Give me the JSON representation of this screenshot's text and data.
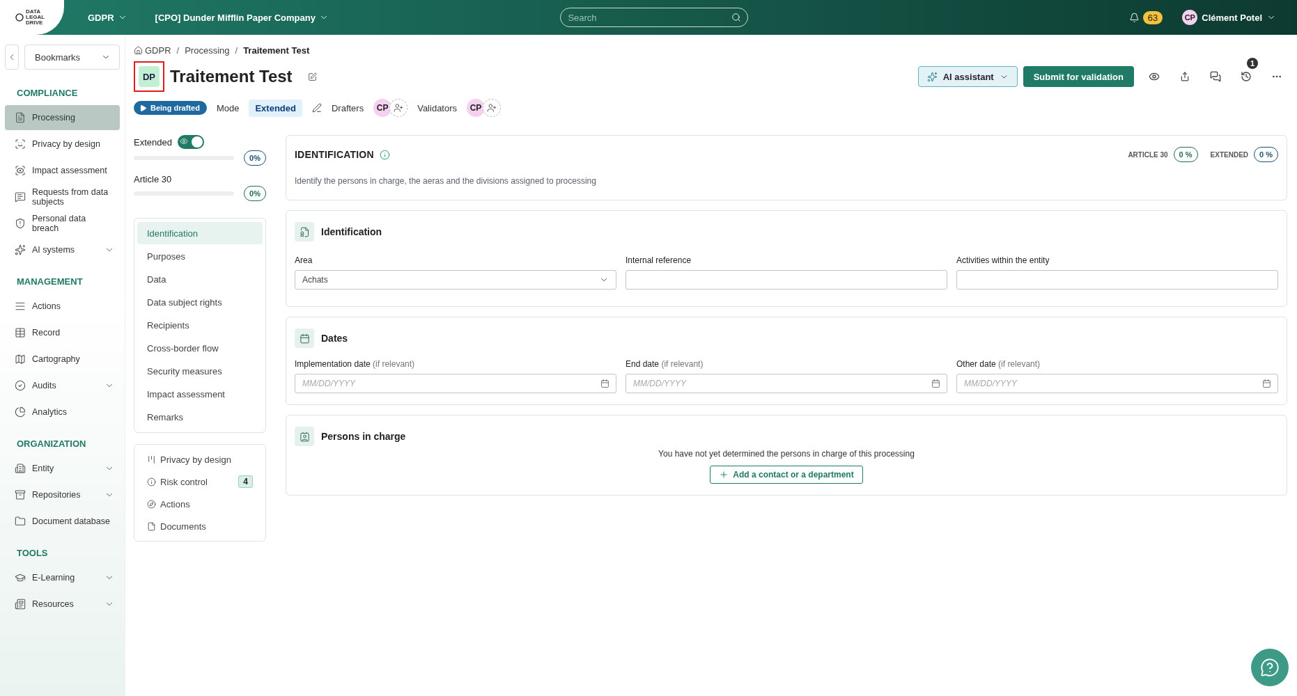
{
  "topbar": {
    "logo_lines": [
      "DATA",
      "LEGAL",
      "DRIVE"
    ],
    "module": "GDPR",
    "company": "[CPO] Dunder Mifflin Paper Company",
    "search": {
      "placeholder": "Search"
    },
    "notifications": "63",
    "user": {
      "initials": "CP",
      "name": "Clément Potel"
    }
  },
  "sidebar": {
    "bookmarks": "Bookmarks",
    "sections": [
      {
        "title": "COMPLIANCE",
        "items": [
          {
            "label": "Processing",
            "selected": true,
            "submenu": false
          },
          {
            "label": "Privacy by design",
            "selected": false,
            "submenu": false
          },
          {
            "label": "Impact assessment",
            "selected": false,
            "submenu": false
          },
          {
            "label": "Requests from data subjects",
            "selected": false,
            "submenu": false
          },
          {
            "label": "Personal data breach",
            "selected": false,
            "submenu": false
          },
          {
            "label": "AI systems",
            "selected": false,
            "submenu": true
          }
        ]
      },
      {
        "title": "MANAGEMENT",
        "items": [
          {
            "label": "Actions",
            "selected": false,
            "submenu": false
          },
          {
            "label": "Record",
            "selected": false,
            "submenu": false
          },
          {
            "label": "Cartography",
            "selected": false,
            "submenu": false
          },
          {
            "label": "Audits",
            "selected": false,
            "submenu": true
          },
          {
            "label": "Analytics",
            "selected": false,
            "submenu": false
          }
        ]
      },
      {
        "title": "ORGANIZATION",
        "items": [
          {
            "label": "Entity",
            "selected": false,
            "submenu": true
          },
          {
            "label": "Repositories",
            "selected": false,
            "submenu": true
          },
          {
            "label": "Document database",
            "selected": false,
            "submenu": false
          }
        ]
      },
      {
        "title": "TOOLS",
        "items": [
          {
            "label": "E-Learning",
            "selected": false,
            "submenu": true
          },
          {
            "label": "Resources",
            "selected": false,
            "submenu": true
          }
        ]
      }
    ]
  },
  "breadcrumb": [
    "GDPR",
    "Processing",
    "Traitement Test"
  ],
  "breadcrumb_separator": "/",
  "header": {
    "badge": "DP",
    "highlighted": true,
    "title": "Traitement Test",
    "ai_button": "AI assistant",
    "submit_button": "Submit for validation",
    "history_count": "1"
  },
  "status_row": {
    "status": "Being drafted",
    "mode_label": "Mode",
    "mode": "Extended",
    "drafters_label": "Drafters",
    "drafters": [
      "CP"
    ],
    "validators_label": "Validators",
    "validators": [
      "CP"
    ]
  },
  "progress": [
    {
      "label": "Extended",
      "on": true,
      "level": 0,
      "reading": "0%",
      "color": "#1d4f73"
    },
    {
      "label": "Article 30",
      "level": 0,
      "reading": "0%",
      "color": "#1f6b55"
    }
  ],
  "nav": [
    {
      "label": "Identification",
      "selected": true
    },
    {
      "label": "Purposes",
      "selected": false
    },
    {
      "label": "Data",
      "selected": false
    },
    {
      "label": "Data subject rights",
      "selected": false
    },
    {
      "label": "Recipients",
      "selected": false
    },
    {
      "label": "Cross-border flow",
      "selected": false
    },
    {
      "label": "Security measures",
      "selected": false
    },
    {
      "label": "Impact assessment",
      "selected": false
    },
    {
      "label": "Remarks",
      "selected": false
    }
  ],
  "links": [
    {
      "label": "Privacy by design"
    },
    {
      "label": "Risk control",
      "count": "4"
    },
    {
      "label": "Actions"
    },
    {
      "label": "Documents"
    }
  ],
  "intro": {
    "title": "IDENTIFICATION",
    "description": "Identify the persons in charge, the aeras and the divisions assigned to processing",
    "scores": [
      {
        "label": "ARTICLE 30",
        "value": "0 %",
        "color": "#1f6b55"
      },
      {
        "label": "EXTENDED",
        "value": "0 %",
        "color": "#1d4f73"
      }
    ]
  },
  "sections": [
    {
      "kind": "fields",
      "title": "Identification",
      "fields": [
        {
          "kind": "select",
          "label": "Area",
          "value": "Achats"
        },
        {
          "kind": "text",
          "label": "Internal reference"
        },
        {
          "kind": "text",
          "label": "Activities within the entity"
        }
      ]
    },
    {
      "kind": "fields",
      "title": "Dates",
      "fields": [
        {
          "kind": "date",
          "label": "Implementation date",
          "hint": "(if relevant)",
          "placeholder": "MM/DD/YYYY"
        },
        {
          "kind": "date",
          "label": "End date",
          "hint": "(if relevant)",
          "placeholder": "MM/DD/YYYY"
        },
        {
          "kind": "date",
          "label": "Other date",
          "hint": "(if relevant)",
          "placeholder": "MM/DD/YYYY"
        }
      ]
    },
    {
      "kind": "empty",
      "title": "Persons in charge",
      "message": "You have not yet determined the persons in charge of this processing",
      "button": "Add a contact or a department"
    }
  ]
}
